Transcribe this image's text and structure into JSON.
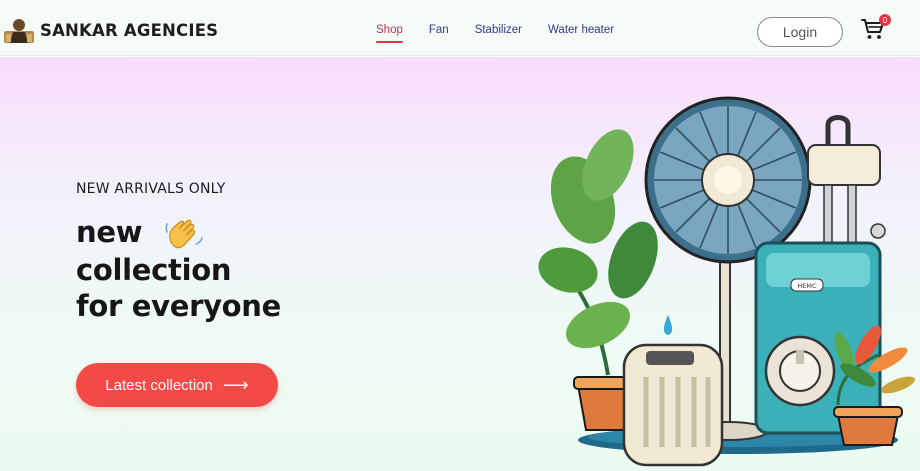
{
  "brand": {
    "name": "SANKAR AGENCIES",
    "logo_icon": "person-logo-icon"
  },
  "nav": {
    "items": [
      {
        "label": "Shop",
        "active": true
      },
      {
        "label": "Fan",
        "active": false
      },
      {
        "label": "Stabilizer",
        "active": false
      },
      {
        "label": "Water heater",
        "active": false
      }
    ]
  },
  "header_actions": {
    "login_label": "Login",
    "cart_icon": "cart-icon",
    "cart_count": "0"
  },
  "hero": {
    "eyebrow": "NEW ARRIVALS ONLY",
    "headline_line1": "new",
    "headline_line2": "collection",
    "headline_line3": "for everyone",
    "wave_icon": "waving-hand-icon",
    "cta_label": "Latest collection",
    "cta_icon": "arrow-right-icon",
    "heater_label": "HEMC"
  },
  "colors": {
    "accent": "#f34a47",
    "nav_link": "#2f3a8f",
    "nav_active": "#c2334d"
  }
}
